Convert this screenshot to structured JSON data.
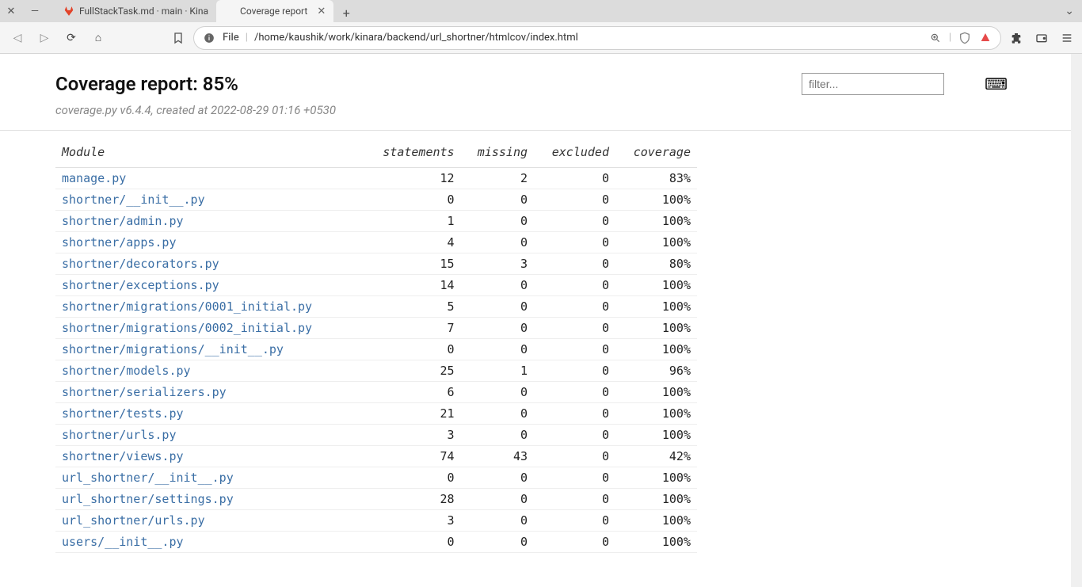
{
  "window": {
    "tabs": [
      {
        "title": "FullStackTask.md · main · Kina",
        "active": false,
        "kind": "gitlab"
      },
      {
        "title": "Coverage report",
        "active": true,
        "kind": "coverage"
      }
    ]
  },
  "address_bar": {
    "scheme_label": "File",
    "path": "/home/kaushik/work/kinara/backend/url_shortner/htmlcov/index.html"
  },
  "page": {
    "title": "Coverage report: 85%",
    "subtitle": "coverage.py v6.4.4, created at 2022-08-29 01:16 +0530",
    "filter_placeholder": "filter..."
  },
  "columns": {
    "module": "Module",
    "statements": "statements",
    "missing": "missing",
    "excluded": "excluded",
    "coverage": "coverage"
  },
  "rows": [
    {
      "module": "manage.py",
      "statements": "12",
      "missing": "2",
      "excluded": "0",
      "coverage": "83%"
    },
    {
      "module": "shortner/__init__.py",
      "statements": "0",
      "missing": "0",
      "excluded": "0",
      "coverage": "100%"
    },
    {
      "module": "shortner/admin.py",
      "statements": "1",
      "missing": "0",
      "excluded": "0",
      "coverage": "100%"
    },
    {
      "module": "shortner/apps.py",
      "statements": "4",
      "missing": "0",
      "excluded": "0",
      "coverage": "100%"
    },
    {
      "module": "shortner/decorators.py",
      "statements": "15",
      "missing": "3",
      "excluded": "0",
      "coverage": "80%"
    },
    {
      "module": "shortner/exceptions.py",
      "statements": "14",
      "missing": "0",
      "excluded": "0",
      "coverage": "100%"
    },
    {
      "module": "shortner/migrations/0001_initial.py",
      "statements": "5",
      "missing": "0",
      "excluded": "0",
      "coverage": "100%"
    },
    {
      "module": "shortner/migrations/0002_initial.py",
      "statements": "7",
      "missing": "0",
      "excluded": "0",
      "coverage": "100%"
    },
    {
      "module": "shortner/migrations/__init__.py",
      "statements": "0",
      "missing": "0",
      "excluded": "0",
      "coverage": "100%"
    },
    {
      "module": "shortner/models.py",
      "statements": "25",
      "missing": "1",
      "excluded": "0",
      "coverage": "96%"
    },
    {
      "module": "shortner/serializers.py",
      "statements": "6",
      "missing": "0",
      "excluded": "0",
      "coverage": "100%"
    },
    {
      "module": "shortner/tests.py",
      "statements": "21",
      "missing": "0",
      "excluded": "0",
      "coverage": "100%"
    },
    {
      "module": "shortner/urls.py",
      "statements": "3",
      "missing": "0",
      "excluded": "0",
      "coverage": "100%"
    },
    {
      "module": "shortner/views.py",
      "statements": "74",
      "missing": "43",
      "excluded": "0",
      "coverage": "42%"
    },
    {
      "module": "url_shortner/__init__.py",
      "statements": "0",
      "missing": "0",
      "excluded": "0",
      "coverage": "100%"
    },
    {
      "module": "url_shortner/settings.py",
      "statements": "28",
      "missing": "0",
      "excluded": "0",
      "coverage": "100%"
    },
    {
      "module": "url_shortner/urls.py",
      "statements": "3",
      "missing": "0",
      "excluded": "0",
      "coverage": "100%"
    },
    {
      "module": "users/__init__.py",
      "statements": "0",
      "missing": "0",
      "excluded": "0",
      "coverage": "100%"
    }
  ]
}
